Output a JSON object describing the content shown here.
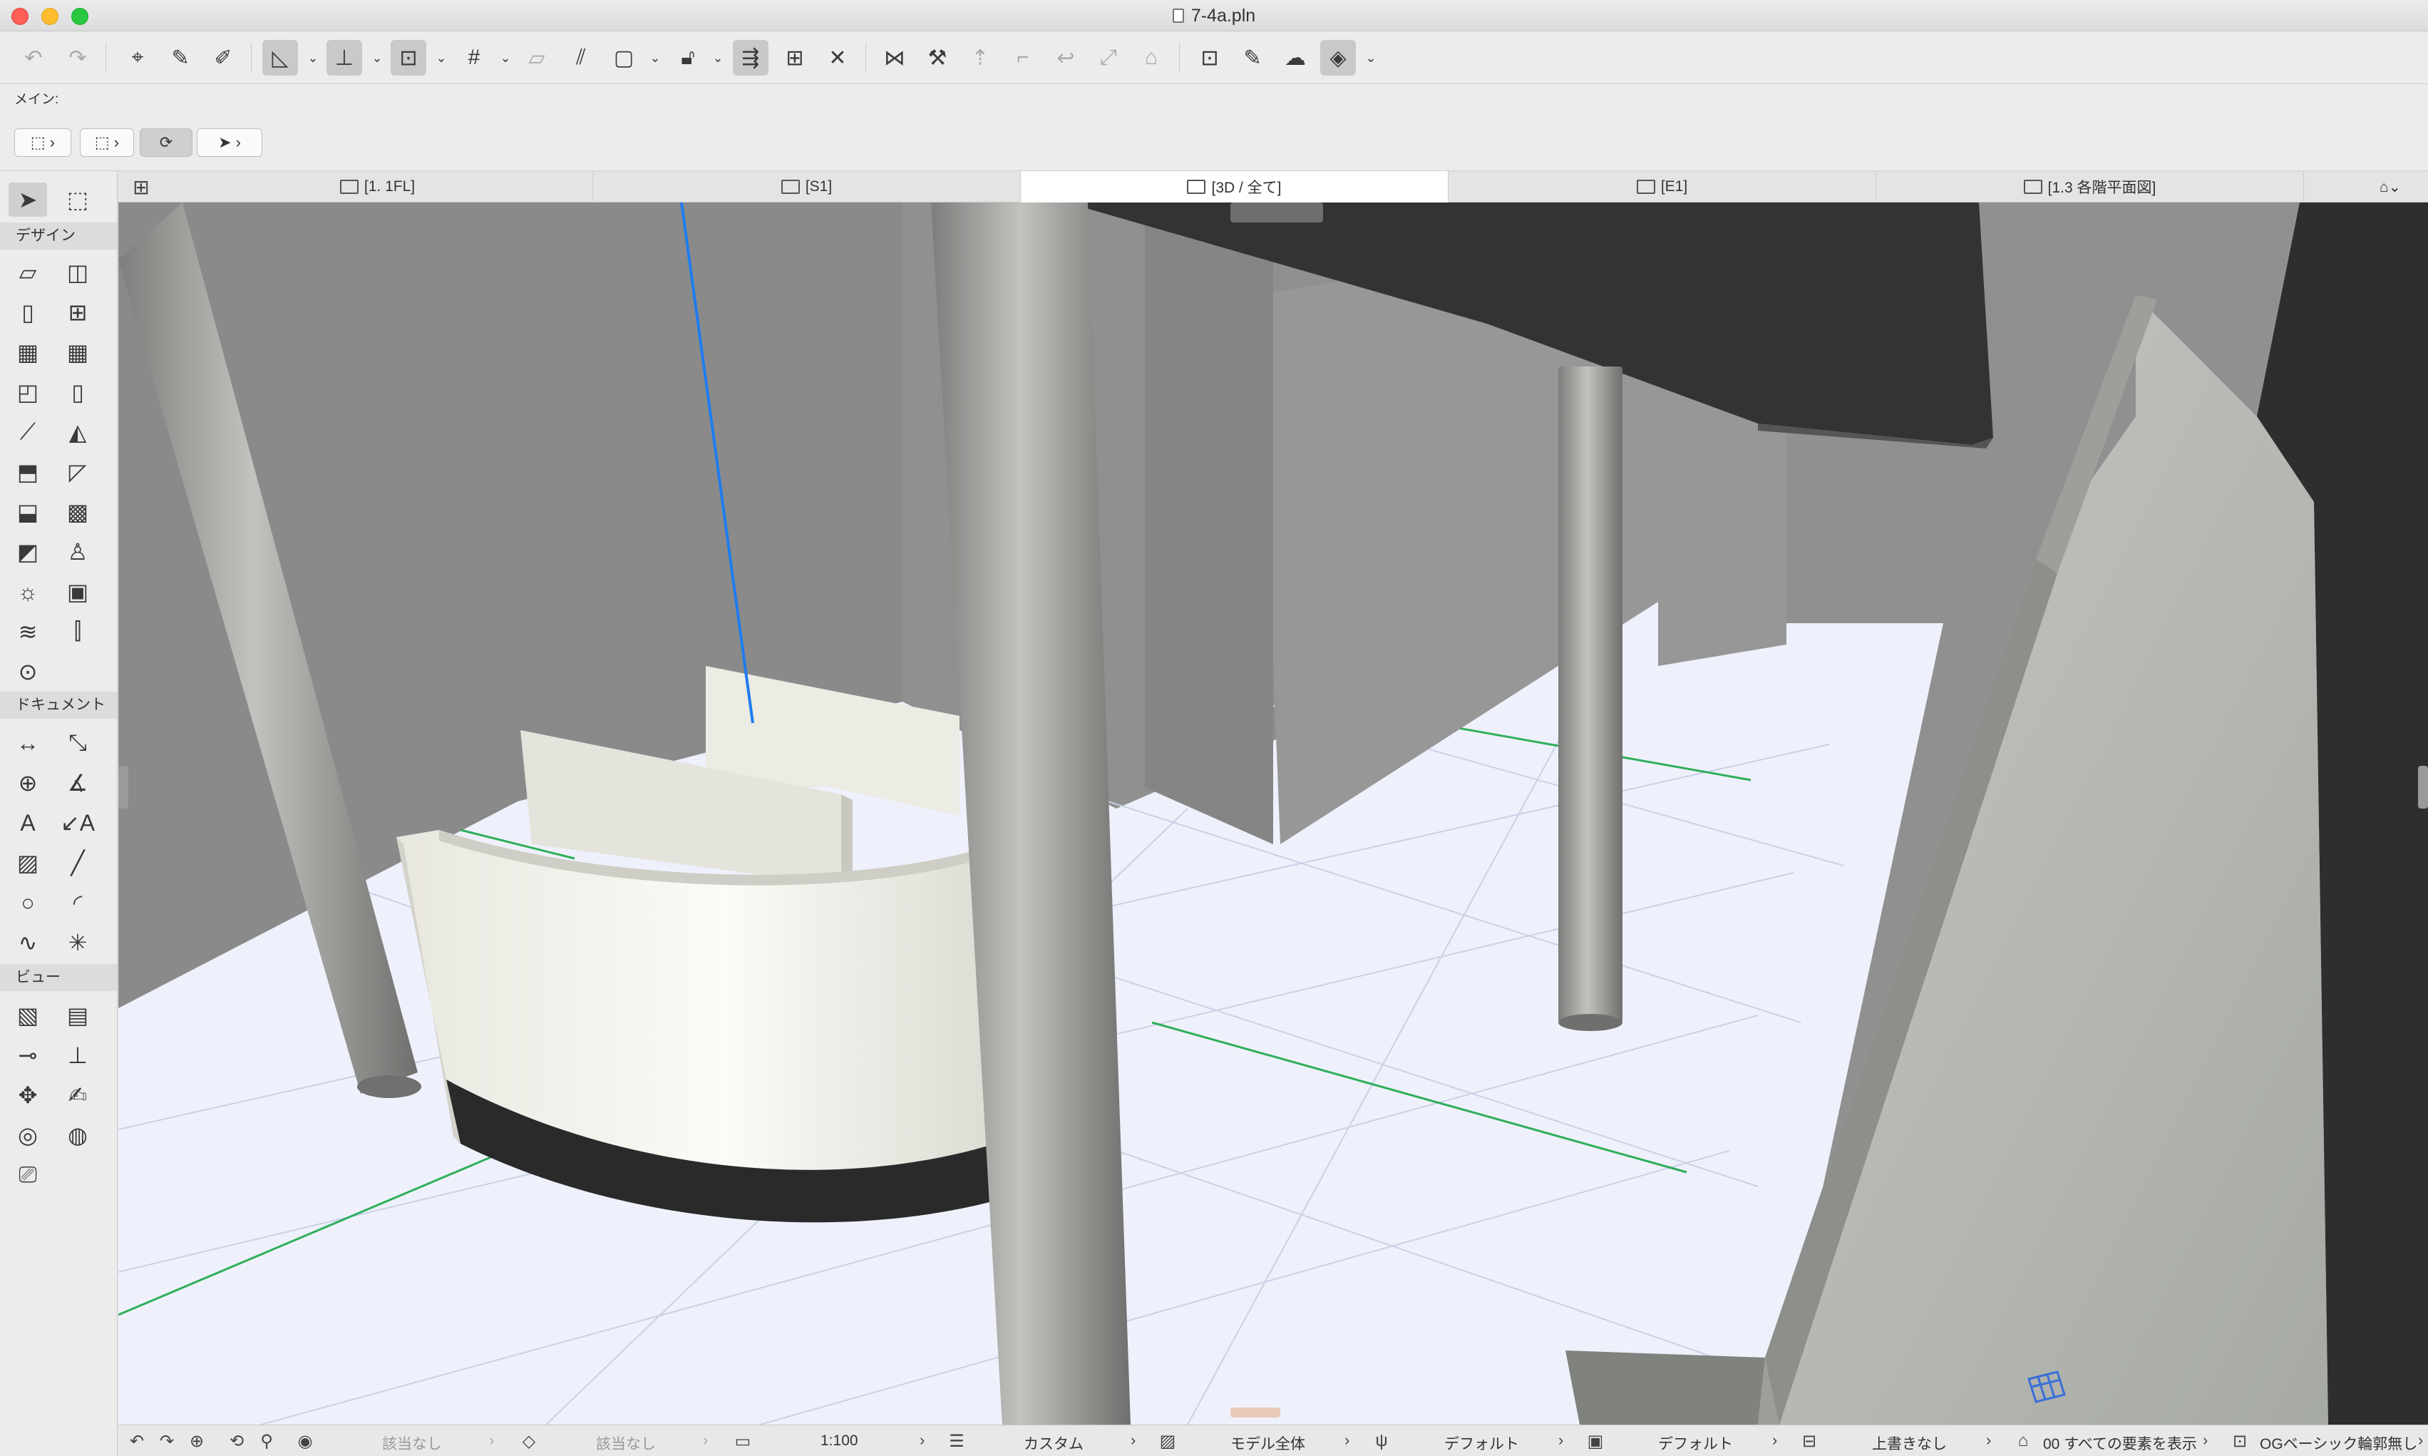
{
  "window": {
    "title": "7-4a.pln"
  },
  "infobox": {
    "label": "メイン:"
  },
  "tabs": [
    {
      "label": "[1. 1FL]",
      "icon": "floor-plan-icon"
    },
    {
      "label": "[S1]",
      "icon": "section-icon"
    },
    {
      "label": "[3D / 全て]",
      "icon": "3d-view-icon",
      "active": true
    },
    {
      "label": "[E1]",
      "icon": "elevation-icon"
    },
    {
      "label": "[1.3 各階平面図]",
      "icon": "layout-icon"
    }
  ],
  "toolbox": {
    "design_header": "デザイン",
    "document_header": "ドキュメント",
    "view_header": "ビュー"
  },
  "statusbar": {
    "undo_label": "該当なし",
    "layer_label": "該当なし",
    "scale": "1:100",
    "layer_combo": "カスタム",
    "model_view": "モデル全体",
    "pen_set": "デフォルト",
    "dimension": "デフォルト",
    "override": "上書きなし",
    "renovation": "00 すべての要素を表示",
    "structure": "OGベーシック輪郭無し"
  },
  "colors": {
    "floor": "#eef1fb",
    "wall": "#8e8e8e",
    "column": "#a4a4a4",
    "counter": "#f4f3ec",
    "counter_base": "#2b2b2b",
    "ceiling": "#2f2f2f",
    "ramp": "#b6b8b4",
    "grid_line": "#c8d0e4",
    "axis_green": "#2fae5a",
    "axis_blue": "#1e7cf0"
  }
}
